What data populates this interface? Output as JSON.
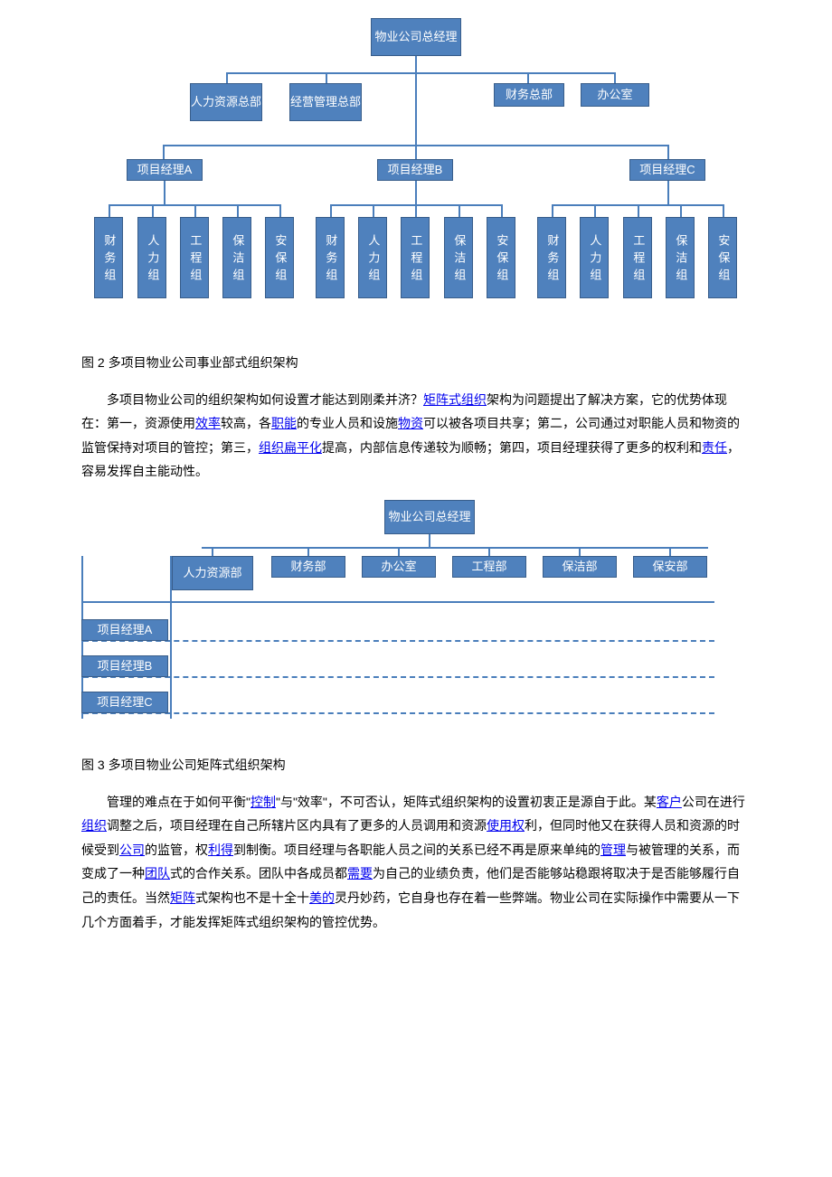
{
  "figure2_caption": "图 2 多项目物业公司事业部式组织架构",
  "figure3_caption": "图 3 多项目物业公司矩阵式组织架构",
  "para1": {
    "t1": "多项目物业公司的组织架构如何设置才能达到刚柔并济？",
    "link_matrix": "矩阵式组织",
    "t2": "架构为问题提出了解决方案，它的优势体现在：第一，资源使用",
    "link_eff": "效率",
    "t3": "较高，各",
    "link_func": "职能",
    "t4": "的专业人员和设施",
    "link_material": "物资",
    "t5": "可以被各项目共享；第二，公司通过对职能人员和物资的监管保持对项目的管控；第三，",
    "link_flat": "组织扁平化",
    "t6": "提高，内部信息传递较为顺畅；第四，项目经理获得了更多的权利和",
    "link_duty": "责任",
    "t7": "，容易发挥自主能动性。"
  },
  "para2": {
    "t1": "管理的难点在于如何平衡\"",
    "link_ctrl": "控制",
    "t2": "\"与\"效率\"，不可否认，矩阵式组织架构的设置初衷正是源自于此。某",
    "link_cust": "客户",
    "t3": "公司在进行",
    "link_org": "组织",
    "t4": "调整之后，项目经理在自己所辖片区内具有了更多的人员调用和资源",
    "link_use": "使用权",
    "t5": "利，但同时他又在获得人员和资源的时候受到",
    "link_co": "公司",
    "t6": "的监管，权",
    "link_gain": "利得",
    "t7": "到制衡。项目经理与各职能人员之间的关系已经不再是原来单纯的",
    "link_mgmt": "管理",
    "t8": "与被管理的关系，而变成了一种",
    "link_team": "团队",
    "t9": "式的合作关系。团队中各成员都",
    "link_need": "需要",
    "t10": "为自己的业绩负责，他们是否能够站稳跟将取决于是否能够履行自己的责任。当然",
    "link_matrix2": "矩阵",
    "t11": "式架构也不是十全十",
    "link_mei": "美的",
    "t12": "灵丹妙药，它自身也存在着一些弊端。物业公司在实际操作中需要从一下几个方面着手，才能发挥矩阵式组织架构的管控优势。"
  },
  "chart_data": [
    {
      "type": "tree",
      "title": "多项目物业公司事业部式组织架构",
      "root": "物业公司总经理",
      "tier2": [
        "人力资源总部",
        "经营管理总部",
        "财务总部",
        "办公室"
      ],
      "tier3": [
        "项目经理A",
        "项目经理B",
        "项目经理C"
      ],
      "tier4_under_each_pm": [
        "财务组",
        "人力组",
        "工程组",
        "保洁组",
        "安保组"
      ]
    },
    {
      "type": "matrix",
      "title": "多项目物业公司矩阵式组织架构",
      "root": "物业公司总经理",
      "columns": [
        "人力资源部",
        "财务部",
        "办公室",
        "工程部",
        "保洁部",
        "保安部"
      ],
      "rows": [
        "项目经理A",
        "项目经理B",
        "项目经理C"
      ]
    }
  ]
}
